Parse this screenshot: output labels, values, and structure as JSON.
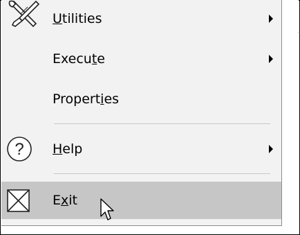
{
  "menu": {
    "items": [
      {
        "pre": "",
        "ul": "U",
        "post": "tilities",
        "icon": "tools-icon",
        "submenu": true
      },
      {
        "pre": "Execu",
        "ul": "t",
        "post": "e",
        "icon": "",
        "submenu": true
      },
      {
        "pre": "Propert",
        "ul": "i",
        "post": "es",
        "icon": "",
        "submenu": false
      },
      {
        "pre": "",
        "ul": "H",
        "post": "elp",
        "icon": "help-circle-icon",
        "submenu": true
      },
      {
        "pre": "E",
        "ul": "x",
        "post": "it",
        "icon": "exit-box-icon",
        "submenu": false,
        "highlighted": true
      }
    ]
  },
  "colors": {
    "menu_bg": "#f2f2f2",
    "highlight_bg": "#c6c6c6",
    "separator": "#c8c8c8"
  },
  "cursor": {
    "icon": "arrow-cursor-icon"
  }
}
